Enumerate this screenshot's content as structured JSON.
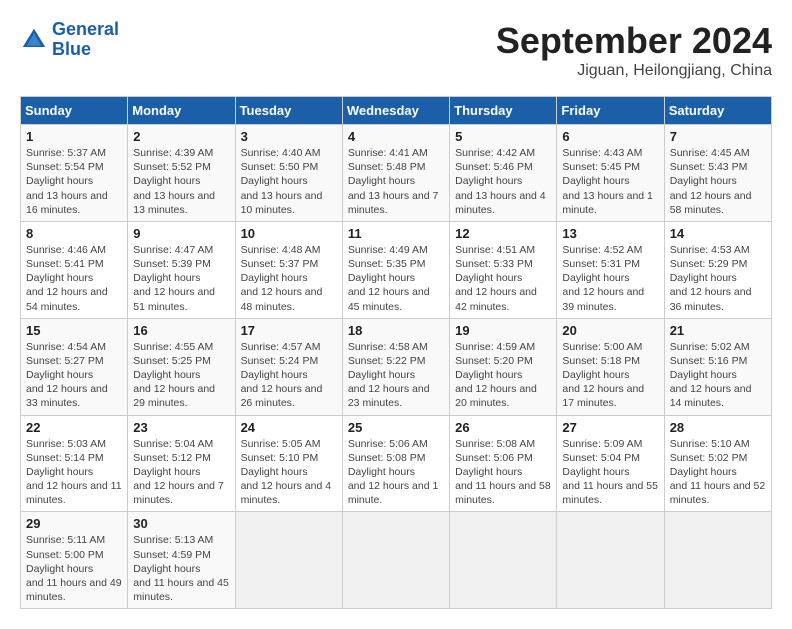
{
  "header": {
    "logo_line1": "General",
    "logo_line2": "Blue",
    "month": "September 2024",
    "location": "Jiguan, Heilongjiang, China"
  },
  "days_of_week": [
    "Sunday",
    "Monday",
    "Tuesday",
    "Wednesday",
    "Thursday",
    "Friday",
    "Saturday"
  ],
  "weeks": [
    [
      {
        "num": "1",
        "rise": "5:37 AM",
        "set": "5:54 PM",
        "daylight": "13 hours and 16 minutes."
      },
      {
        "num": "2",
        "rise": "4:39 AM",
        "set": "5:52 PM",
        "daylight": "13 hours and 13 minutes."
      },
      {
        "num": "3",
        "rise": "4:40 AM",
        "set": "5:50 PM",
        "daylight": "13 hours and 10 minutes."
      },
      {
        "num": "4",
        "rise": "4:41 AM",
        "set": "5:48 PM",
        "daylight": "13 hours and 7 minutes."
      },
      {
        "num": "5",
        "rise": "4:42 AM",
        "set": "5:46 PM",
        "daylight": "13 hours and 4 minutes."
      },
      {
        "num": "6",
        "rise": "4:43 AM",
        "set": "5:45 PM",
        "daylight": "13 hours and 1 minute."
      },
      {
        "num": "7",
        "rise": "4:45 AM",
        "set": "5:43 PM",
        "daylight": "12 hours and 58 minutes."
      }
    ],
    [
      {
        "num": "8",
        "rise": "4:46 AM",
        "set": "5:41 PM",
        "daylight": "12 hours and 54 minutes."
      },
      {
        "num": "9",
        "rise": "4:47 AM",
        "set": "5:39 PM",
        "daylight": "12 hours and 51 minutes."
      },
      {
        "num": "10",
        "rise": "4:48 AM",
        "set": "5:37 PM",
        "daylight": "12 hours and 48 minutes."
      },
      {
        "num": "11",
        "rise": "4:49 AM",
        "set": "5:35 PM",
        "daylight": "12 hours and 45 minutes."
      },
      {
        "num": "12",
        "rise": "4:51 AM",
        "set": "5:33 PM",
        "daylight": "12 hours and 42 minutes."
      },
      {
        "num": "13",
        "rise": "4:52 AM",
        "set": "5:31 PM",
        "daylight": "12 hours and 39 minutes."
      },
      {
        "num": "14",
        "rise": "4:53 AM",
        "set": "5:29 PM",
        "daylight": "12 hours and 36 minutes."
      }
    ],
    [
      {
        "num": "15",
        "rise": "4:54 AM",
        "set": "5:27 PM",
        "daylight": "12 hours and 33 minutes."
      },
      {
        "num": "16",
        "rise": "4:55 AM",
        "set": "5:25 PM",
        "daylight": "12 hours and 29 minutes."
      },
      {
        "num": "17",
        "rise": "4:57 AM",
        "set": "5:24 PM",
        "daylight": "12 hours and 26 minutes."
      },
      {
        "num": "18",
        "rise": "4:58 AM",
        "set": "5:22 PM",
        "daylight": "12 hours and 23 minutes."
      },
      {
        "num": "19",
        "rise": "4:59 AM",
        "set": "5:20 PM",
        "daylight": "12 hours and 20 minutes."
      },
      {
        "num": "20",
        "rise": "5:00 AM",
        "set": "5:18 PM",
        "daylight": "12 hours and 17 minutes."
      },
      {
        "num": "21",
        "rise": "5:02 AM",
        "set": "5:16 PM",
        "daylight": "12 hours and 14 minutes."
      }
    ],
    [
      {
        "num": "22",
        "rise": "5:03 AM",
        "set": "5:14 PM",
        "daylight": "12 hours and 11 minutes."
      },
      {
        "num": "23",
        "rise": "5:04 AM",
        "set": "5:12 PM",
        "daylight": "12 hours and 7 minutes."
      },
      {
        "num": "24",
        "rise": "5:05 AM",
        "set": "5:10 PM",
        "daylight": "12 hours and 4 minutes."
      },
      {
        "num": "25",
        "rise": "5:06 AM",
        "set": "5:08 PM",
        "daylight": "12 hours and 1 minute."
      },
      {
        "num": "26",
        "rise": "5:08 AM",
        "set": "5:06 PM",
        "daylight": "11 hours and 58 minutes."
      },
      {
        "num": "27",
        "rise": "5:09 AM",
        "set": "5:04 PM",
        "daylight": "11 hours and 55 minutes."
      },
      {
        "num": "28",
        "rise": "5:10 AM",
        "set": "5:02 PM",
        "daylight": "11 hours and 52 minutes."
      }
    ],
    [
      {
        "num": "29",
        "rise": "5:11 AM",
        "set": "5:00 PM",
        "daylight": "11 hours and 49 minutes."
      },
      {
        "num": "30",
        "rise": "5:13 AM",
        "set": "4:59 PM",
        "daylight": "11 hours and 45 minutes."
      },
      null,
      null,
      null,
      null,
      null
    ]
  ]
}
